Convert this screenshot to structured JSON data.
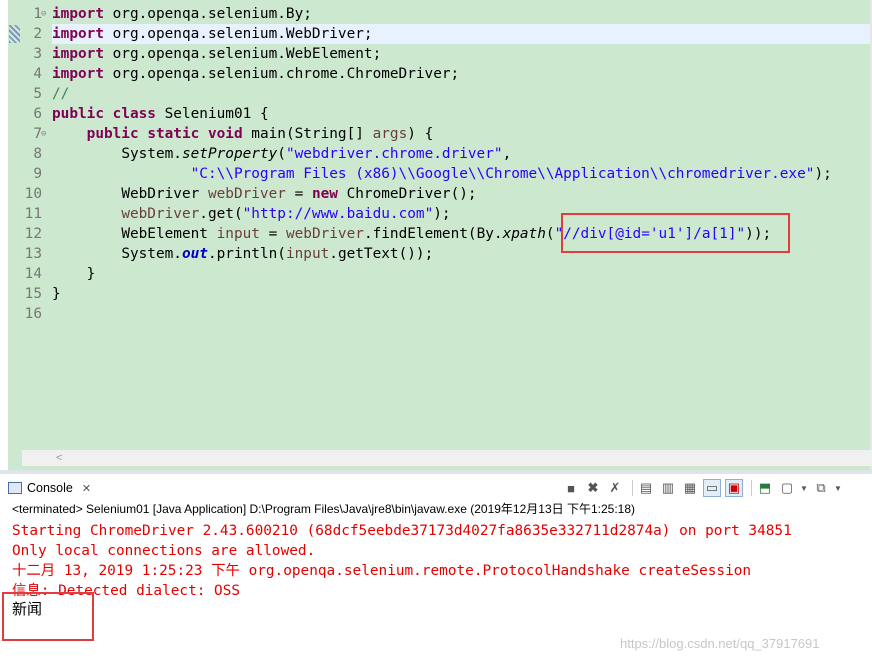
{
  "editor": {
    "line_numbers": [
      "1",
      "2",
      "3",
      "4",
      "5",
      "6",
      "7",
      "8",
      "9",
      "10",
      "11",
      "12",
      "13",
      "14",
      "15",
      "16"
    ],
    "fold_markers": [
      "⊖",
      "⊖"
    ],
    "lines": {
      "l1": {
        "kw": "import",
        "rest": " org.openqa.selenium.By;"
      },
      "l2": {
        "kw": "import",
        "rest": " org.openqa.selenium.WebDriver;"
      },
      "l3": {
        "kw": "import",
        "rest": " org.openqa.selenium.WebElement;"
      },
      "l4": {
        "kw": "import",
        "rest": " org.openqa.selenium.chrome.ChromeDriver;"
      },
      "l5": {
        "comment": "//"
      },
      "l6": {
        "kw1": "public",
        "sp": " ",
        "kw2": "class",
        "rest": " Selenium01 {"
      },
      "l7": {
        "indent": "    ",
        "kw1": "public",
        "kw2": "static",
        "kw3": "void",
        "rest1": " main(String[] ",
        "param": "args",
        "rest2": ") {"
      },
      "l8": {
        "indent": "        ",
        "a": "System.",
        "method": "setProperty",
        "b": "(",
        "str": "\"webdriver.chrome.driver\"",
        "c": ","
      },
      "l9": {
        "indent": "                ",
        "str": "\"C:\\\\Program Files (x86)\\\\Google\\\\Chrome\\\\Application\\\\chromedriver.exe\"",
        "c": ");"
      },
      "l10": {
        "indent": "        ",
        "a": "WebDriver ",
        "var": "webDriver",
        "b": " = ",
        "kw": "new",
        "c": " ChromeDriver();"
      },
      "l11": {
        "indent": "        ",
        "var": "webDriver",
        "a": ".get(",
        "str": "\"http://www.baidu.com\"",
        "b": ");"
      },
      "l12": {
        "indent": "        ",
        "a": "WebElement ",
        "var1": "input",
        "b": " = ",
        "var2": "webDriver",
        "c": ".findElement(By.",
        "method": "xpath",
        "d": "(",
        "str": "\"//div[@id='u1']/a[1]\"",
        "e": "));"
      },
      "l13": {
        "indent": "        ",
        "a": "System.",
        "field": "out",
        "b": ".println(",
        "var": "input",
        "c": ".getText());"
      },
      "l14": {
        "text": "    }"
      },
      "l15": {
        "text": "}"
      },
      "l16": {
        "text": ""
      }
    }
  },
  "console": {
    "tab_label": "Console",
    "status": "<terminated> Selenium01 [Java Application] D:\\Program Files\\Java\\jre8\\bin\\javaw.exe (2019年12月13日 下午1:25:18)",
    "lines": [
      "Starting ChromeDriver 2.43.600210 (68dcf5eebde37173d4027fa8635e332711d2874a) on port 34851",
      "Only local connections are allowed.",
      "十二月 13, 2019 1:25:23 下午 org.openqa.selenium.remote.ProtocolHandshake createSession",
      "信息: Detected dialect: OSS"
    ],
    "output": "新闻"
  },
  "watermark": "https://blog.csdn.net/qq_37917691",
  "colors": {
    "keyword": "#7f0055",
    "string": "#2a00ff",
    "comment": "#3f7f5f",
    "stderr": "#e60000",
    "highlight_box": "#e23c3c",
    "editor_bg": "#cce8cf"
  },
  "icons": [
    "console-icon",
    "close-icon",
    "terminate-icon",
    "remove-launch-icon",
    "remove-all-icon",
    "scroll-lock-icon",
    "word-wrap-icon",
    "show-stdout-icon",
    "show-stderr-icon",
    "pin-console-icon",
    "display-console-icon",
    "new-console-icon"
  ]
}
